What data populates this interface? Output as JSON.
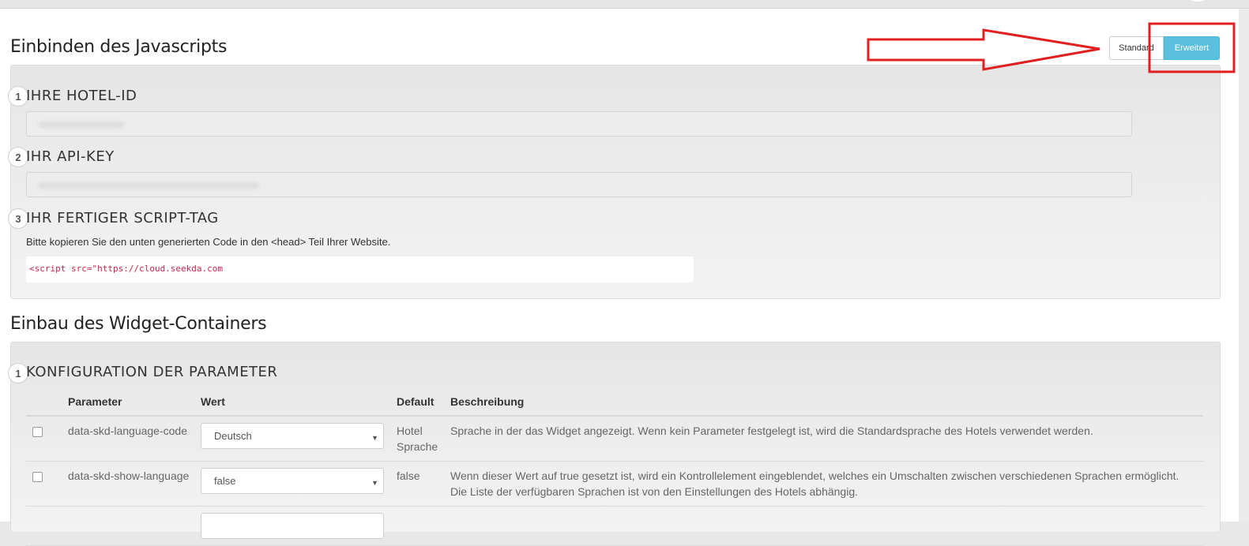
{
  "section1": {
    "title": "Einbinden des Javascripts",
    "toggle": {
      "standard_label": "Standard",
      "advanced_label": "Erweitert",
      "active": "Erweitert"
    },
    "steps": [
      {
        "number": "1",
        "label": "IHRE HOTEL-ID"
      },
      {
        "number": "2",
        "label": "IHR API-KEY"
      },
      {
        "number": "3",
        "label": "IHR FERTIGER SCRIPT-TAG"
      }
    ],
    "help_text": "Bitte kopieren Sie den unten generierten Code in den <head> Teil Ihrer Website.",
    "script_code": "<script src=\"https://cloud.seekda.com"
  },
  "section2": {
    "title": "Einbau des Widget-Containers",
    "step": {
      "number": "1",
      "label": "KONFIGURATION DER PARAMETER"
    },
    "table": {
      "headers": {
        "parameter": "Parameter",
        "value": "Wert",
        "default": "Default",
        "description": "Beschreibung"
      },
      "rows": [
        {
          "parameter": "data-skd-language-code",
          "value": "Deutsch",
          "default": "Hotel Sprache",
          "description": "Sprache in der das Widget angezeigt. Wenn kein Parameter festgelegt ist, wird die Standardsprache des Hotels verwendet werden."
        },
        {
          "parameter": "data-skd-show-language",
          "value": "false",
          "default": "false",
          "description": "Wenn dieser Wert auf true gesetzt ist, wird ein Kontrollelement eingeblendet, welches ein Umschalten zwischen verschiedenen Sprachen ermöglicht. Die Liste der verfügbaren Sprachen ist von den Einstellungen des Hotels abhängig."
        }
      ]
    }
  },
  "colors": {
    "accent": "#5bc0de",
    "annotation_red": "#e02020",
    "code_text": "#c7254e"
  }
}
